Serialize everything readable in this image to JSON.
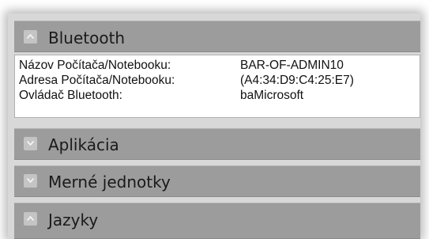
{
  "sections": [
    {
      "title": "Bluetooth",
      "expanded": true,
      "toggle_icon": "chevron-up-icon",
      "details": [
        {
          "label": "Názov Počítača/Notebooku:",
          "value": "BAR-OF-ADMIN10"
        },
        {
          "label": "Adresa Počítača/Notebooku:",
          "value": "(A4:34:D9:C4:25:E7)"
        },
        {
          "label": "Ovládač Bluetooth:",
          "value": "baMicrosoft"
        }
      ]
    },
    {
      "title": "Aplikácia",
      "expanded": false,
      "toggle_icon": "chevron-down-icon"
    },
    {
      "title": "Merné jednotky",
      "expanded": false,
      "toggle_icon": "chevron-down-icon"
    },
    {
      "title": "Jazyky",
      "expanded": false,
      "toggle_icon": "chevron-up-icon"
    }
  ],
  "colors": {
    "header_bg": "#9c9c9c",
    "frame_bg": "#d8d8d8",
    "icon_bg": "#c4c4c4",
    "details_bg": "#ffffff"
  }
}
